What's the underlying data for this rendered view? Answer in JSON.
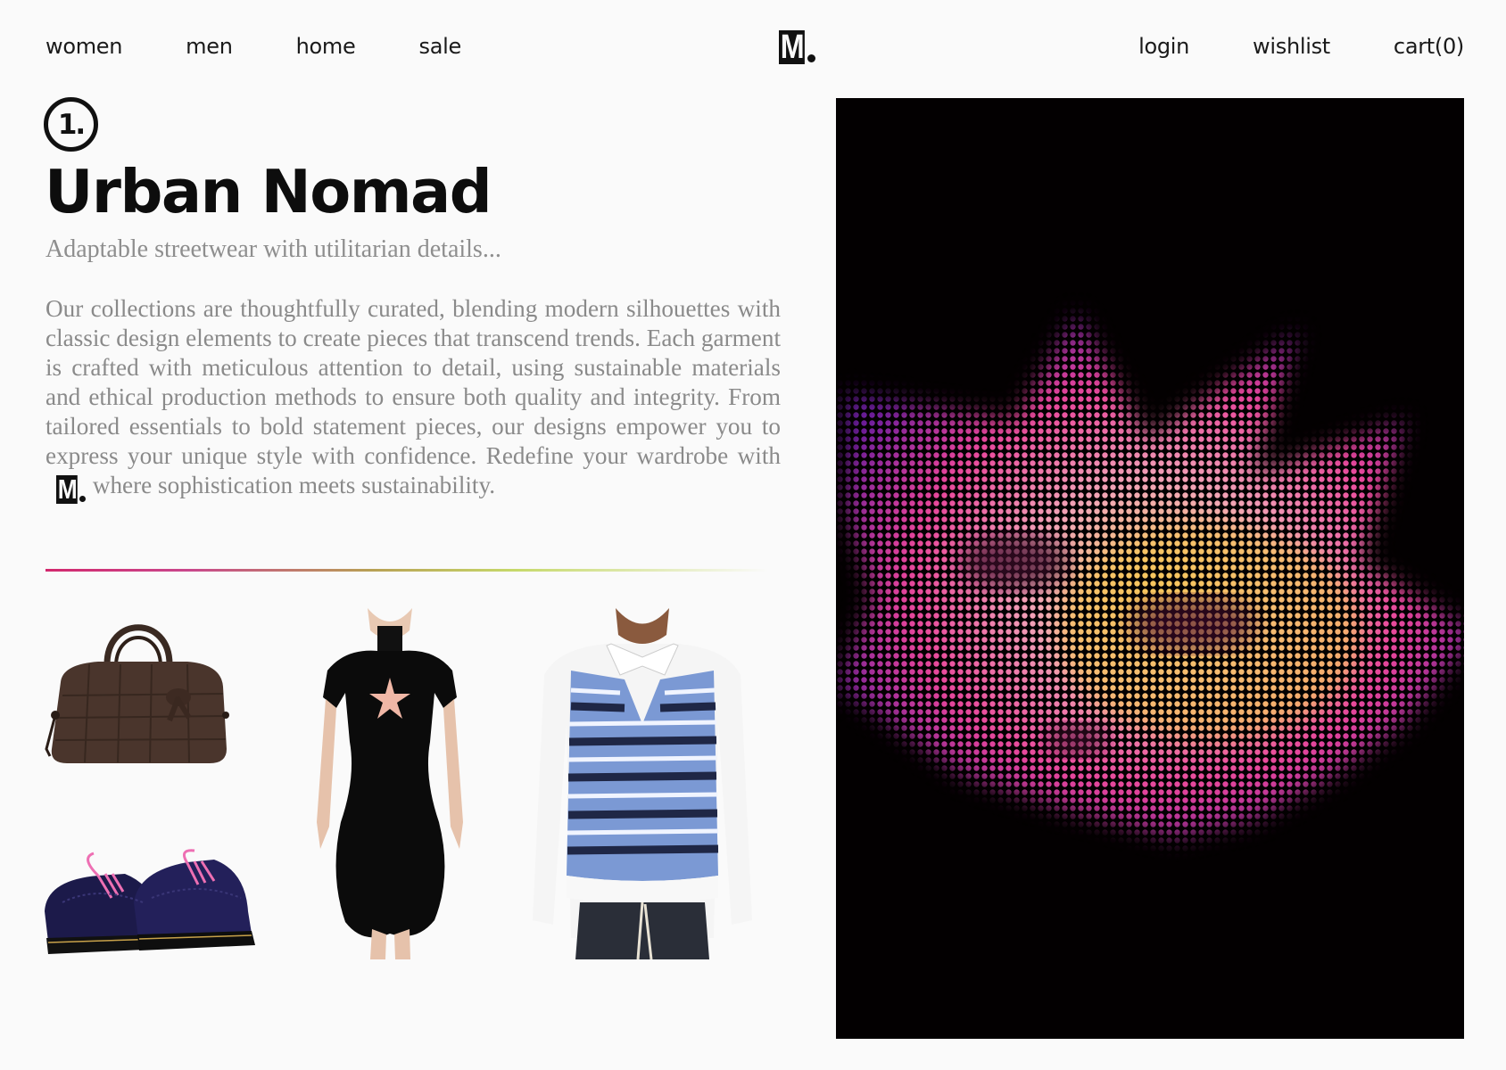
{
  "nav": {
    "left": [
      "women",
      "men",
      "home",
      "sale"
    ],
    "right": [
      "login",
      "wishlist",
      "cart(0)"
    ],
    "logo": "M"
  },
  "collection": {
    "number": "1.",
    "title": "Urban Nomad",
    "subtitle": "Adaptable streetwear with utilitarian details...",
    "body_before_logo": "Our collections are thoughtfully curated, blending modern silhouettes with classic design elements to create pieces that transcend trends. Each garment is crafted with meticulous attention to detail, using sustainable materials and ethical production methods to ensure both quality and integrity. From tailored essentials to bold statement pieces, our designs empower you to express your unique style with confidence. Redefine your wardrobe with",
    "body_after_logo": "where sophistication meets sustainability."
  },
  "products": [
    {
      "name": "brown croc-embossed suede handbag"
    },
    {
      "name": "navy suede lace-up shoes with pink laces"
    },
    {
      "name": "black short-sleeve mini dress with star"
    },
    {
      "name": "blue striped knit vest over white shirt"
    }
  ],
  "colors": {
    "background": "#fafafa",
    "text": "#111111",
    "muted_text": "#8a8a8a",
    "divider_start": "#d2286d",
    "divider_mid": "#c6d96a",
    "hero_bg": "#030001",
    "hero_flower": "#e8449a"
  }
}
